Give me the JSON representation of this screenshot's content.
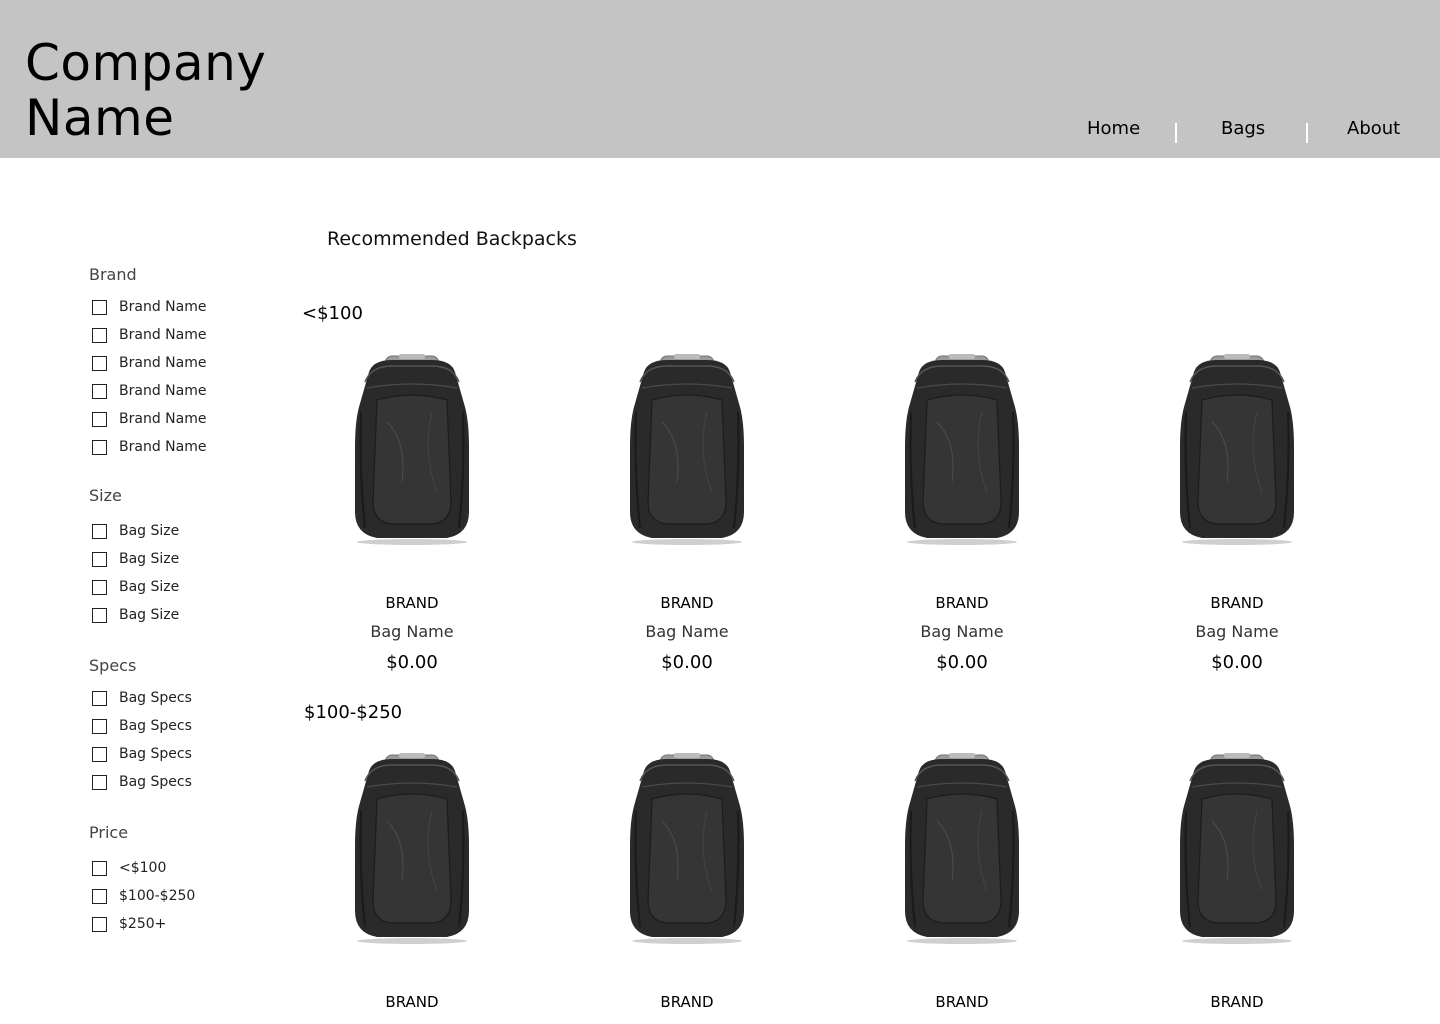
{
  "header": {
    "logo_line1": "Company",
    "logo_line2": "Name",
    "nav": [
      "Home",
      "Bags",
      "About"
    ]
  },
  "filters": {
    "brand": {
      "title": "Brand",
      "options": [
        "Brand Name",
        "Brand Name",
        "Brand Name",
        "Brand Name",
        "Brand Name",
        "Brand Name"
      ]
    },
    "size": {
      "title": "Size",
      "options": [
        "Bag Size",
        "Bag Size",
        "Bag Size",
        "Bag Size"
      ]
    },
    "specs": {
      "title": "Specs",
      "options": [
        "Bag Specs",
        "Bag Specs",
        "Bag Specs",
        "Bag Specs"
      ]
    },
    "price": {
      "title": "Price",
      "options": [
        "<$100",
        "$100-$250",
        "$250+"
      ]
    }
  },
  "main": {
    "title": "Recommended Backpacks",
    "groups": [
      {
        "label": "<$100",
        "products": [
          {
            "brand": "BRAND",
            "name": "Bag Name",
            "price": "$0.00"
          },
          {
            "brand": "BRAND",
            "name": "Bag Name",
            "price": "$0.00"
          },
          {
            "brand": "BRAND",
            "name": "Bag Name",
            "price": "$0.00"
          },
          {
            "brand": "BRAND",
            "name": "Bag Name",
            "price": "$0.00"
          }
        ]
      },
      {
        "label": "$100-$250",
        "products": [
          {
            "brand": "BRAND"
          },
          {
            "brand": "BRAND"
          },
          {
            "brand": "BRAND"
          },
          {
            "brand": "BRAND"
          }
        ]
      }
    ]
  },
  "colors": {
    "header_bg": "#c4c4c4",
    "bag_body": "#2a2a2a"
  },
  "icons": [
    "checkbox-icon",
    "backpack-image"
  ]
}
